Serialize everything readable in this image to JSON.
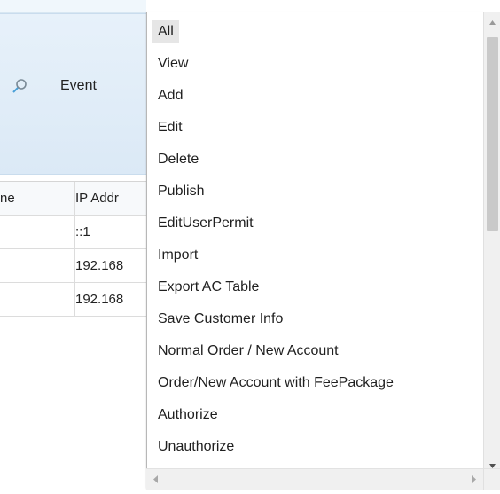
{
  "filter_panel": {
    "event_label": "Event",
    "search_icon": "search-icon"
  },
  "table": {
    "headers": [
      "ne",
      "IP Addr"
    ],
    "rows": [
      [
        "",
        "::1"
      ],
      [
        "",
        "192.168"
      ],
      [
        "",
        "192.168"
      ]
    ]
  },
  "dropdown": {
    "options": [
      {
        "label": "All",
        "selected": true
      },
      {
        "label": "View"
      },
      {
        "label": "Add"
      },
      {
        "label": "Edit"
      },
      {
        "label": "Delete"
      },
      {
        "label": "Publish"
      },
      {
        "label": "EditUserPermit"
      },
      {
        "label": "Import"
      },
      {
        "label": "Export AC Table"
      },
      {
        "label": "Save Customer Info"
      },
      {
        "label": "Normal Order / New Account"
      },
      {
        "label": "Order/New Account with FeePackage"
      },
      {
        "label": "Authorize"
      },
      {
        "label": "Unauthorize"
      }
    ],
    "selected_value": "All"
  },
  "scrollbars": {
    "vertical_icons": [
      "up-arrow-icon",
      "down-arrow-icon"
    ],
    "horizontal_icons": [
      "left-arrow-icon",
      "right-arrow-icon"
    ]
  }
}
